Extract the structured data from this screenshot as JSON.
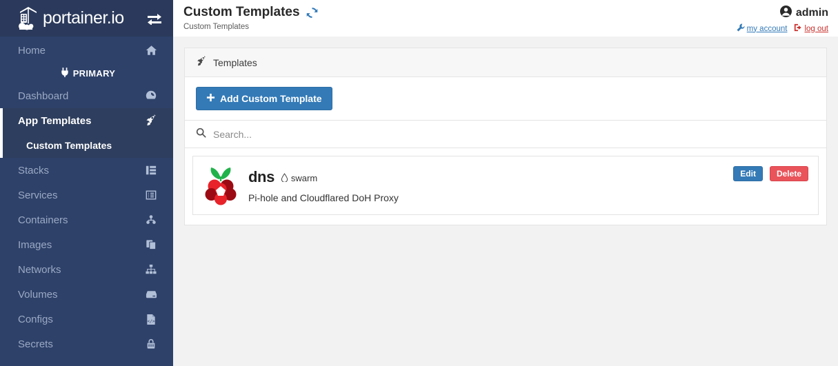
{
  "sidebar": {
    "brand": {
      "text": "portainer.io",
      "logo_icon": "portainer-crane-logo",
      "toggle_icon": "exchange-arrows-icon"
    },
    "endpoint": {
      "label": "PRIMARY",
      "icon": "plug-icon"
    },
    "items": [
      {
        "label": "Home",
        "icon": "home-icon",
        "active": false
      },
      {
        "label": "Dashboard",
        "icon": "dashboard-gauge-icon",
        "active": false
      },
      {
        "label": "App Templates",
        "icon": "rocket-icon",
        "active": true
      },
      {
        "label": "Stacks",
        "icon": "stacks-grid-icon",
        "active": false
      },
      {
        "label": "Services",
        "icon": "services-list-icon",
        "active": false
      },
      {
        "label": "Containers",
        "icon": "containers-icon",
        "active": false
      },
      {
        "label": "Images",
        "icon": "images-copy-icon",
        "active": false
      },
      {
        "label": "Networks",
        "icon": "networks-sitemap-icon",
        "active": false
      },
      {
        "label": "Volumes",
        "icon": "volumes-hdd-icon",
        "active": false
      },
      {
        "label": "Configs",
        "icon": "configs-file-code-icon",
        "active": false
      },
      {
        "label": "Secrets",
        "icon": "secrets-lock-icon",
        "active": false
      }
    ],
    "sub_item": {
      "label": "Custom Templates"
    }
  },
  "header": {
    "title": "Custom Templates",
    "subtitle": "Custom Templates",
    "refresh_icon": "refresh-sync-icon",
    "user": {
      "name": "admin",
      "avatar_icon": "user-circle-icon",
      "my_account_label": "my account",
      "my_account_icon": "wrench-icon",
      "logout_label": "log out",
      "logout_icon": "sign-out-icon"
    }
  },
  "panel": {
    "title": "Templates",
    "title_icon": "rocket-icon",
    "add_button": {
      "label": "Add Custom Template",
      "icon": "plus-icon"
    },
    "search": {
      "placeholder": "Search...",
      "value": "",
      "icon": "search-icon"
    }
  },
  "templates": [
    {
      "name": "dns",
      "type": "swarm",
      "type_icon": "swarm-icon",
      "description": "Pi-hole and Cloudflared DoH Proxy",
      "logo_icon": "raspberry-pi-logo",
      "edit_label": "Edit",
      "delete_label": "Delete"
    }
  ],
  "colors": {
    "sidebar_bg": "#2e4169",
    "sidebar_header_bg": "#2b3a5c",
    "sidebar_active_bg": "#2e3e5e",
    "accent_blue": "#337ab7",
    "danger_red": "#e9535a",
    "link_red": "#c9302c",
    "content_bg": "#f2f2f2"
  }
}
